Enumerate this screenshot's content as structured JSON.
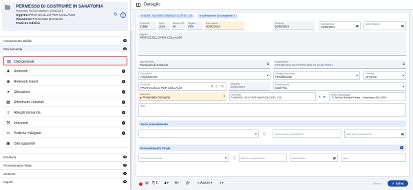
{
  "sidebar": {
    "title": "PERMESSO DI COSTRUIRE IN SANATORIA",
    "protocol_line": "Protocollo: 00/2024 aperta il: 18/06/2024",
    "subject_label": "Oggetto:",
    "subject_value": "PROTOCOLLO PER COLLAUDI",
    "status_label": "Situazione:",
    "status_value": "Presentata Domanda",
    "office": "Pratiche Edilizie",
    "sections": {
      "avanzamento": "Avanzamento attività",
      "dati_domanda": "Dati domanda",
      "istruttoria": "Istruttoria",
      "provvedimento": "Provvedimento finale",
      "gestione": "Gestione",
      "importi": "Importi"
    },
    "items": [
      {
        "label": "Dati generali"
      },
      {
        "label": "Referenti"
      },
      {
        "label": "Referenti interni"
      },
      {
        "label": "Ubicazioni"
      },
      {
        "label": "Riferimenti catastali"
      },
      {
        "label": "Allegati domanda"
      },
      {
        "label": "Interventi"
      },
      {
        "label": "Pratiche collegate"
      },
      {
        "label": "Dati aggiuntivi"
      }
    ]
  },
  "header": {
    "title": "Dettaglio"
  },
  "chips": {
    "municipality": "13165 - OLGIATE COMASCO (COSTI) - CO",
    "adempimenti": "Adempimenti da completare: 1"
  },
  "fields": {
    "row1": [
      {
        "label": "Protocollo",
        "value": "21986"
      },
      {
        "label": "Anno",
        "value": "2024"
      },
      {
        "label": "Numero PE",
        "value": "00"
      },
      {
        "label": "Registro",
        "value": "PDC"
      },
      {
        "label": "Data istanza",
        "value": "00/00/2024"
      },
      {
        "label": "Chiusura",
        "value": "00/00/2024"
      },
      {
        "label": "Data apertura",
        "value": "18/06/2024"
      },
      {
        "label": "Data chiusura",
        "value": ""
      }
    ],
    "oggetto_label": "Oggetto",
    "oggetto_value": "PROTOCOLLO PER COLLAUDI",
    "tipo_label": "Tipo intervento",
    "tipo_value": "Permesso di Costruire",
    "proc_label": "Procedimento",
    "proc_value": "PERMESSO DI COSTRUIRE IN SANATORIA",
    "tipo_pratica_label": "Tipo pratica",
    "tipo_pratica_value": "Ampliamento",
    "dest_label": "Dettaglio tipo pratica",
    "dest_value": "Residenziale",
    "onerosa_label": "Onerosa",
    "onerosa_value": "Onerosa",
    "prot_label": "Protocollo",
    "prot_value": "PROTOCOLLO PER COLLAUDI",
    "data_prot_label": "Data prot.",
    "data_prot_value": "18/06/2024",
    "presentazione_label": "Presentazione",
    "presentazione_value": "Mail PEC",
    "situazione_label": "Situazione",
    "situazione_value": "Presentata Domanda",
    "referente_label": "Referente",
    "referente_value": "N.99/2024 <OLA TEST MAGGIOLO DEL 17/0...",
    "ufficio_label": "Ufficio responsabile",
    "ufficio_value": "71 Servizio Edilizia Privata - Urbanistica (ED_SPO...",
    "note_label": "Note"
  },
  "avvio": {
    "title": "Avvio procedimento",
    "num_placeholder": "Numero avvio procedimento",
    "date_placeholder": "Data avvio procedimento"
  },
  "finale": {
    "title": "Provvedimento Finale",
    "tipo_placeholder": "Provvedimento finale",
    "num_placeholder": "Numero provvedimento",
    "date_placeholder": "Data Rilascio",
    "extra_placeholder": "Note"
  },
  "toolbar": {
    "attach_count": "1",
    "azioni_label": "Azioni",
    "indietro_label": "Ritorna",
    "salva_label": "Salva"
  },
  "colors": {
    "accent": "#1d4ea8",
    "highlight": "#dd2222"
  }
}
